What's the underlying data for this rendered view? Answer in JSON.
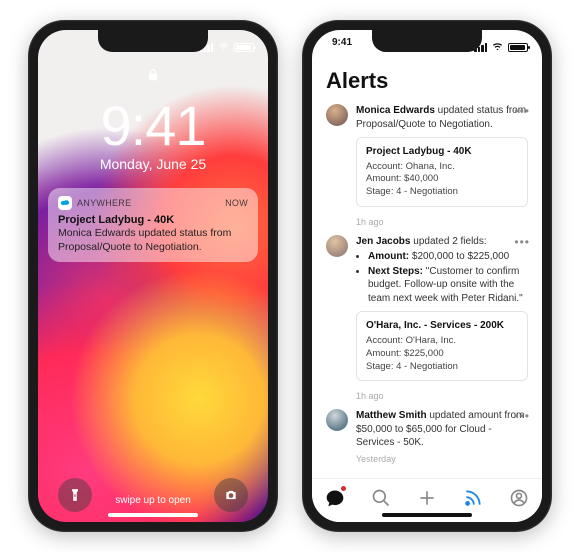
{
  "statusbar": {
    "time": "9:41"
  },
  "lock": {
    "time": "9:41",
    "date": "Monday, June 25",
    "swipe_label": "swipe up to open"
  },
  "notif": {
    "app": "ANYWHERE",
    "when": "now",
    "title": "Project Ladybug - 40K",
    "body": "Monica Edwards updated status from Proposal/Quote to Negotiation."
  },
  "alerts": {
    "title": "Alerts",
    "items": [
      {
        "author": "Monica Edwards",
        "summary_suffix": " updated status from Proposal/Quote to Negotiation.",
        "card": {
          "title": "Project Ladybug - 40K",
          "account_label": "Account:",
          "account": "Ohana, Inc.",
          "amount_label": "Amount:",
          "amount": "$40,000",
          "stage_label": "Stage:",
          "stage": "4 - Negotiation"
        },
        "time": "1h ago"
      },
      {
        "author": "Jen Jacobs",
        "summary_suffix": " updated 2 fields:",
        "bullets": [
          {
            "label": "Amount:",
            "value": "$200,000 to $225,000"
          },
          {
            "label": "Next Steps:",
            "value": "\"Customer to confirm budget. Follow-up onsite with the team next week with Peter Ridani.\""
          }
        ],
        "card": {
          "title": "O'Hara, Inc. - Services - 200K",
          "account_label": "Account:",
          "account": "O'Hara, Inc.",
          "amount_label": "Amount:",
          "amount": "$225,000",
          "stage_label": "Stage:",
          "stage": "4 - Negotiation"
        },
        "time": "1h ago"
      },
      {
        "author": "Matthew Smith",
        "summary_suffix": " updated amount from $50,000 to $65,000 for Cloud - Services - 50K.",
        "time": "Yesterday"
      }
    ]
  },
  "tabbar": {
    "icons": [
      "chat",
      "search",
      "add",
      "feed",
      "profile"
    ]
  }
}
